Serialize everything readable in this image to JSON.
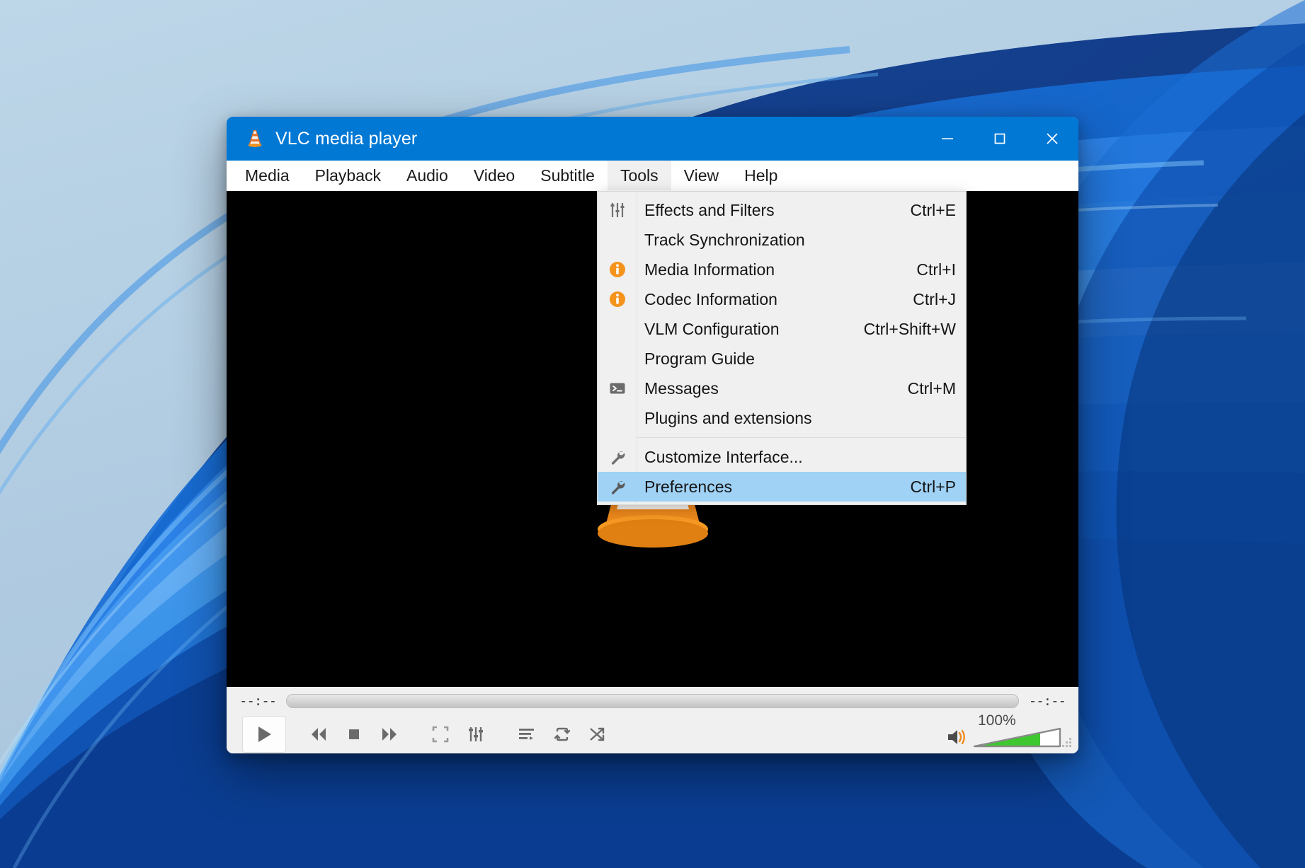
{
  "desktop": {
    "wallpaper_name": "windows-11-bloom-blue",
    "base_color": "#b3cde2",
    "accent_blue": "#0b63d6",
    "deep_blue": "#0a3f9e"
  },
  "window": {
    "title": "VLC media player",
    "app_icon": "vlc-cone-icon",
    "titlebar_color": "#0078d4",
    "controls": {
      "minimize": "minimize-icon",
      "maximize": "maximize-icon",
      "close": "close-icon"
    }
  },
  "menubar": {
    "items": [
      {
        "label": "Media",
        "active": false
      },
      {
        "label": "Playback",
        "active": false
      },
      {
        "label": "Audio",
        "active": false
      },
      {
        "label": "Video",
        "active": false
      },
      {
        "label": "Subtitle",
        "active": false
      },
      {
        "label": "Tools",
        "active": true
      },
      {
        "label": "View",
        "active": false
      },
      {
        "label": "Help",
        "active": false
      }
    ]
  },
  "tools_menu": {
    "highlight_color": "#9fd2f5",
    "background": "#f0f0f0",
    "items": [
      {
        "label": "Effects and Filters",
        "shortcut": "Ctrl+E",
        "icon": "equalizer-sliders-icon",
        "selected": false,
        "separator_after": false
      },
      {
        "label": "Track Synchronization",
        "shortcut": "",
        "icon": "",
        "selected": false,
        "separator_after": false
      },
      {
        "label": "Media Information",
        "shortcut": "Ctrl+I",
        "icon": "info-circle-icon",
        "selected": false,
        "separator_after": false
      },
      {
        "label": "Codec Information",
        "shortcut": "Ctrl+J",
        "icon": "info-circle-icon",
        "selected": false,
        "separator_after": false
      },
      {
        "label": "VLM Configuration",
        "shortcut": "Ctrl+Shift+W",
        "icon": "",
        "selected": false,
        "separator_after": false
      },
      {
        "label": "Program Guide",
        "shortcut": "",
        "icon": "",
        "selected": false,
        "separator_after": false
      },
      {
        "label": "Messages",
        "shortcut": "Ctrl+M",
        "icon": "terminal-icon",
        "selected": false,
        "separator_after": false
      },
      {
        "label": "Plugins and extensions",
        "shortcut": "",
        "icon": "",
        "selected": false,
        "separator_after": true
      },
      {
        "label": "Customize Interface...",
        "shortcut": "",
        "icon": "wrench-icon",
        "selected": false,
        "separator_after": false
      },
      {
        "label": "Preferences",
        "shortcut": "Ctrl+P",
        "icon": "wrench-icon",
        "selected": true,
        "separator_after": false
      }
    ]
  },
  "video": {
    "background": "#000000",
    "watermark_icon": "vlc-cone-watermark"
  },
  "player_controls": {
    "elapsed_time": "--:--",
    "remaining_time": "--:--",
    "seek_position_percent": 0,
    "buttons": [
      {
        "name": "play-button",
        "icon": "play-icon"
      },
      {
        "name": "previous-button",
        "icon": "skip-backward-icon"
      },
      {
        "name": "stop-button",
        "icon": "stop-icon"
      },
      {
        "name": "next-button",
        "icon": "skip-forward-icon"
      },
      {
        "name": "fullscreen-button",
        "icon": "fullscreen-icon"
      },
      {
        "name": "extended-settings-button",
        "icon": "equalizer-sliders-icon"
      },
      {
        "name": "playlist-button",
        "icon": "playlist-icon"
      },
      {
        "name": "loop-button",
        "icon": "loop-icon"
      },
      {
        "name": "shuffle-button",
        "icon": "shuffle-icon"
      }
    ],
    "volume": {
      "label": "100%",
      "value": 100,
      "icon": "speaker-on-icon",
      "fill_color": "#35c935",
      "icon_color": "#ef8b22"
    },
    "resize_grip": "resize-grip-icon"
  }
}
